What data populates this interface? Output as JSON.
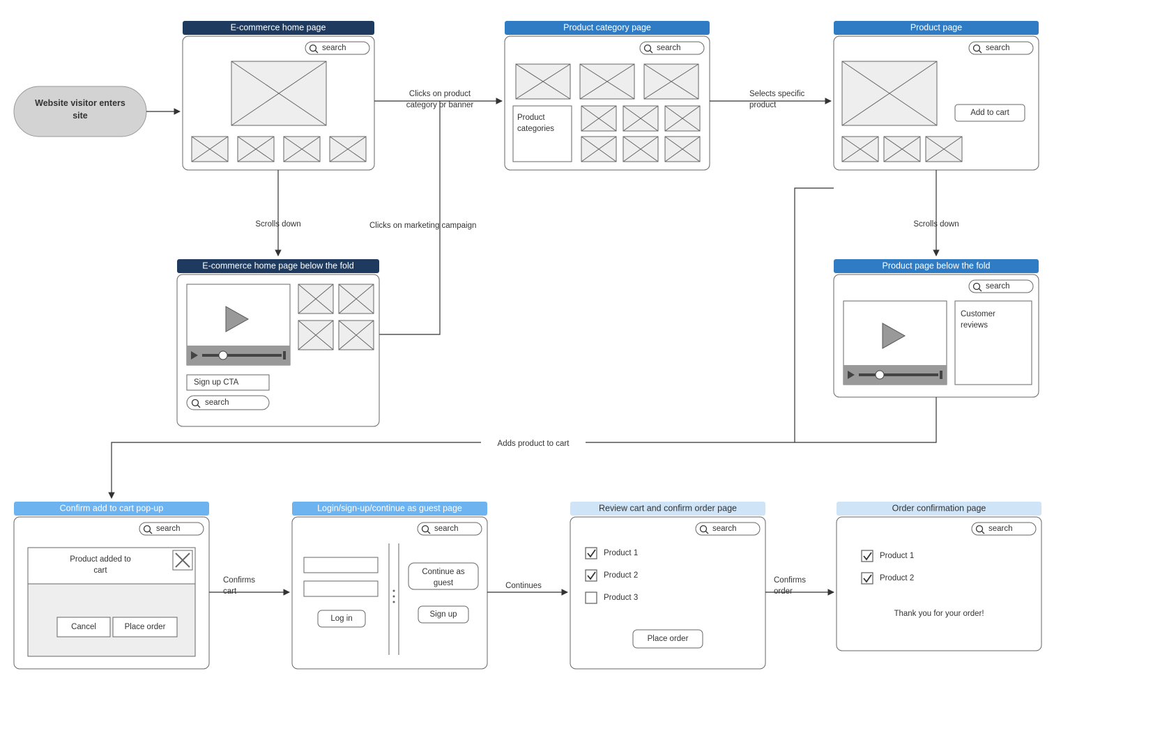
{
  "start": {
    "label1": "Website visitor enters",
    "label2": "site"
  },
  "search_label": "search",
  "nodes": {
    "home": {
      "title": "E-commerce home page"
    },
    "home_fold": {
      "title": "E-commerce home page below the fold",
      "signup_cta": "Sign up CTA"
    },
    "category": {
      "title": "Product category page",
      "cat_label1": "Product",
      "cat_label2": "categories"
    },
    "product": {
      "title": "Product page",
      "add_to_cart": "Add to cart"
    },
    "product_fold": {
      "title": "Product page below the fold",
      "reviews1": "Customer",
      "reviews2": "reviews"
    },
    "confirm_popup": {
      "title": "Confirm add to cart pop-up",
      "popup1": "Product added to",
      "popup2": "cart",
      "cancel": "Cancel",
      "place_order": "Place order"
    },
    "login": {
      "title": "Login/sign-up/continue as guest page",
      "login_btn": "Log in",
      "continue1": "Continue as",
      "continue2": "guest",
      "signup_btn": "Sign up"
    },
    "review": {
      "title": "Review cart and confirm order page",
      "p1": "Product 1",
      "p2": "Product 2",
      "p3": "Product 3",
      "place_order": "Place order"
    },
    "order_conf": {
      "title": "Order confirmation page",
      "p1": "Product 1",
      "p2": "Product 2",
      "thanks": "Thank you for your order!"
    }
  },
  "edges": {
    "scrolls_down": "Scrolls down",
    "clicks_category1": "Clicks on product",
    "clicks_category2": "category or banner",
    "clicks_campaign": "Clicks on marketing campaign",
    "selects_product1": "Selects specific",
    "selects_product2": "product",
    "adds_to_cart": "Adds product to cart",
    "confirms_cart1": "Confirms",
    "confirms_cart2": "cart",
    "continues": "Continues",
    "confirms_order1": "Confirms",
    "confirms_order2": "order"
  }
}
